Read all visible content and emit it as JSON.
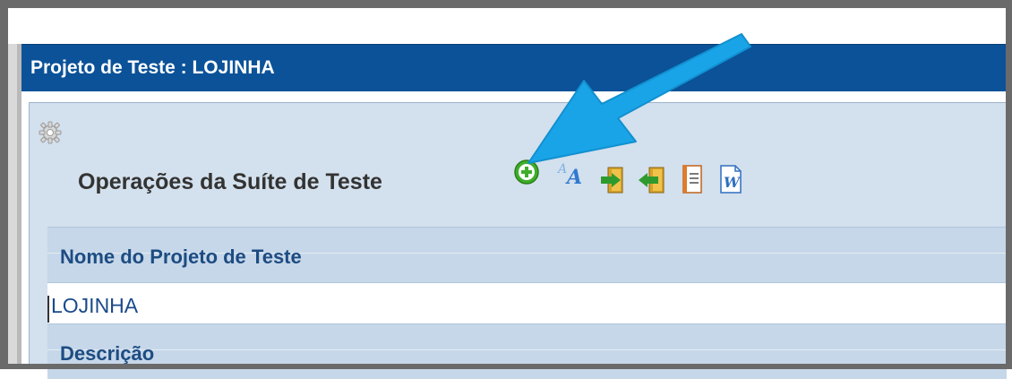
{
  "window": {
    "title": "Projeto de Teste : LOJINHA"
  },
  "toolbar": {
    "section_title": "Operações da Suíte de Teste",
    "icons": [
      "add-icon",
      "translate-icon",
      "import-icon",
      "export-icon",
      "report-icon",
      "word-icon"
    ]
  },
  "fields": {
    "name_label": "Nome do Projeto de Teste",
    "name_value": "LOJINHA",
    "description_label": "Descrição"
  },
  "colors": {
    "title_bar": "#0b5298",
    "panel": "#d3e0ed",
    "header": "#c6d7e9",
    "arrow": "#1aa4e8"
  }
}
